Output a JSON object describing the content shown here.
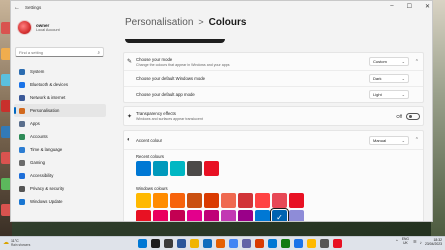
{
  "window": {
    "title": "Settings",
    "back_icon": "back-arrow-icon",
    "controls": [
      "minimize-icon",
      "maximize-icon",
      "close-icon"
    ]
  },
  "profile": {
    "name": "owner",
    "subtitle": "Local Account"
  },
  "search": {
    "placeholder": "Find a setting"
  },
  "sidebar": {
    "items": [
      {
        "label": "System",
        "icon": "monitor-icon",
        "color": "#2b6cb0"
      },
      {
        "label": "Bluetooth & devices",
        "icon": "bluetooth-icon",
        "color": "#1a73e8"
      },
      {
        "label": "Network & internet",
        "icon": "wifi-icon",
        "color": "#3b5998"
      },
      {
        "label": "Personalisation",
        "icon": "paintbrush-icon",
        "color": "#d2691e",
        "selected": true
      },
      {
        "label": "Apps",
        "icon": "apps-icon",
        "color": "#5a6e8c"
      },
      {
        "label": "Accounts",
        "icon": "person-icon",
        "color": "#2e8b57"
      },
      {
        "label": "Time & language",
        "icon": "clock-icon",
        "color": "#2d7dd2"
      },
      {
        "label": "Gaming",
        "icon": "gamepad-icon",
        "color": "#6b6b6b"
      },
      {
        "label": "Accessibility",
        "icon": "accessibility-icon",
        "color": "#1e6fd9"
      },
      {
        "label": "Privacy & security",
        "icon": "shield-icon",
        "color": "#555555"
      },
      {
        "label": "Windows Update",
        "icon": "update-icon",
        "color": "#1976d2"
      }
    ]
  },
  "header": {
    "parent": "Personalisation",
    "separator": ">",
    "current": "Colours"
  },
  "mode": {
    "title": "Choose your mode",
    "subtitle": "Change the colours that appear in Windows and your apps",
    "value": "Custom",
    "windows_mode_label": "Choose your default Windows mode",
    "windows_mode_value": "Dark",
    "app_mode_label": "Choose your default app mode",
    "app_mode_value": "Light"
  },
  "transparency": {
    "title": "Transparency effects",
    "subtitle": "Windows and surfaces appear translucent",
    "state": "Off"
  },
  "accent": {
    "title": "Accent colour",
    "value": "Manual",
    "recent_label": "Recent colours",
    "recent": [
      "#0078d4",
      "#0099bc",
      "#00b7c3",
      "#4c4a48",
      "#e81123"
    ],
    "windows_label": "Windows colours",
    "windows_row1": [
      "#ffb900",
      "#ff8c00",
      "#f7630c",
      "#ca5010",
      "#da3b01",
      "#ef6950",
      "#d13438",
      "#ff4343",
      "#e74856",
      "#e81123"
    ],
    "windows_row2": [
      "#e81123",
      "#ea005e",
      "#c30052",
      "#e3008c",
      "#bf0077",
      "#c239b3",
      "#9a0089",
      "#0078d4",
      "#0063b1",
      "#8e8cd8"
    ],
    "selected_row2_index": 8
  },
  "taskbar": {
    "temperature": "11°C",
    "weather": "Rain showers",
    "language_top": "ENG",
    "language_bottom": "UK",
    "time": "18:32",
    "date": "23/04/2023",
    "apps": [
      "#0078d4",
      "#1e1e1e",
      "#3a3a3a",
      "#2b579a",
      "#f0b400",
      "#0f6cbd",
      "#e66000",
      "#4285f4",
      "#6264a7",
      "#d83b01",
      "#0078d4",
      "#107c10",
      "#1a73e8",
      "#ffb900",
      "#555555",
      "#e81123"
    ]
  }
}
